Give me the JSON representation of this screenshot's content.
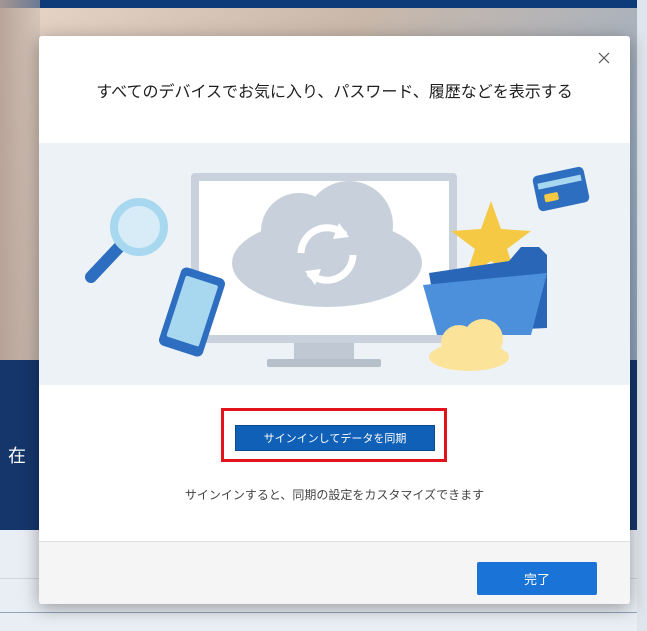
{
  "background": {
    "partial_text": "在"
  },
  "dialog": {
    "title": "すべてのデバイスでお気に入り、パスワード、履歴などを表示する",
    "close_icon": "close-icon",
    "illustration_icons": [
      "magnifier-icon",
      "phone-icon",
      "monitor-icon",
      "cloud-sync-icon",
      "star-icon",
      "folder-icon",
      "card-icon",
      "cloud-icon"
    ],
    "sync_button_label": "サインインしてデータを同期",
    "hint_text": "サインインすると、同期の設定をカスタマイズできます",
    "done_button_label": "完了"
  },
  "colors": {
    "primary": "#1060b8",
    "done_button": "#1a73d6",
    "highlight": "#e3131b"
  }
}
